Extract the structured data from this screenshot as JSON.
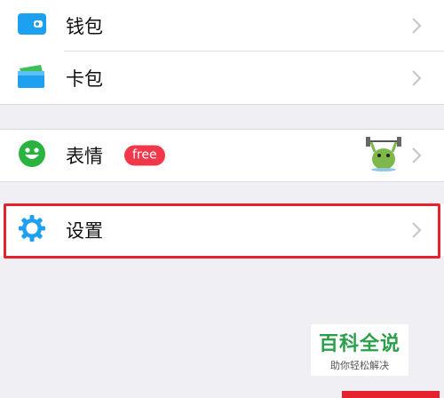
{
  "colors": {
    "highlight": "#e5232f",
    "badge": "#f0384a",
    "wallet_icon": "#1ea0f0",
    "card_icon": "#1ea0f0",
    "emoji_icon": "#2bb33f",
    "gear_icon": "#1ea0f0",
    "watermark_green": "#2ba04a"
  },
  "menu": {
    "wallet": {
      "label": "钱包",
      "icon": "wallet-icon"
    },
    "card": {
      "label": "卡包",
      "icon": "card-pack-icon"
    },
    "emoji": {
      "label": "表情",
      "badge": "free",
      "icon": "smiley-icon",
      "preview": "sticker-preview"
    },
    "settings": {
      "label": "设置",
      "icon": "gear-icon"
    }
  },
  "watermark": {
    "title": "百科全说",
    "subtitle": "助你轻松解决"
  }
}
